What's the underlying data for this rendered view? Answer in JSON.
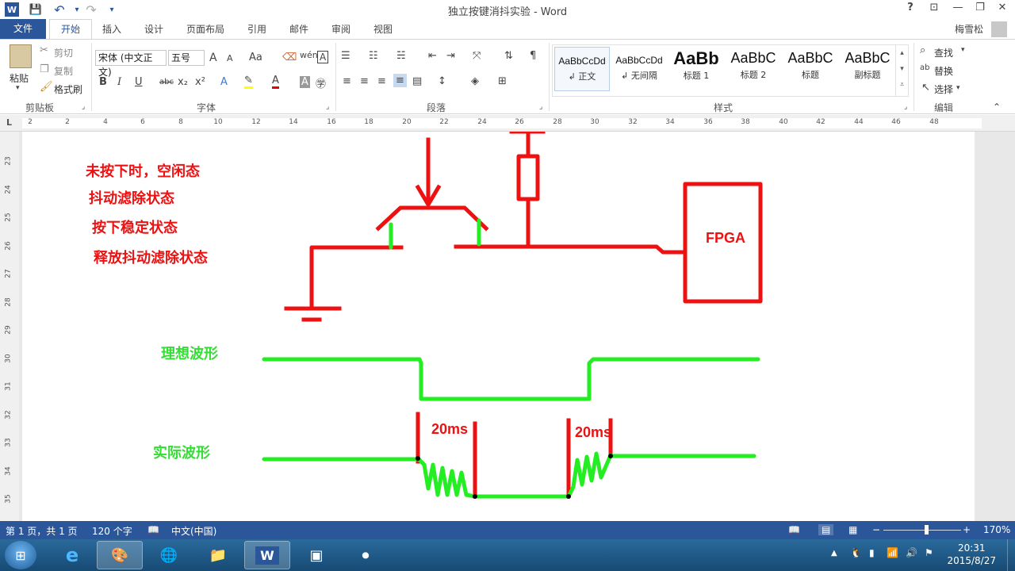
{
  "window": {
    "title": "独立按键消抖实验 - Word",
    "help": "?",
    "ribbon_display": "⊡",
    "minimize": "—",
    "restore": "❐",
    "close": "✕"
  },
  "quick_access": {
    "save": "💾",
    "undo": "↶",
    "redo": "↷",
    "customize": "▾"
  },
  "tabs": [
    "插入",
    "设计",
    "页面布局",
    "引用",
    "邮件",
    "审阅",
    "视图"
  ],
  "file_tab": "文件",
  "home_tab": "开始",
  "user": "梅雪松",
  "ribbon": {
    "clipboard": {
      "paste": "粘贴",
      "cut": "剪切",
      "copy": "复制",
      "format_painter": "格式刷",
      "label": "剪贴板"
    },
    "font": {
      "font_name": "宋体 (中文正文)",
      "font_size": "五号",
      "grow": "A",
      "shrink": "A",
      "change_case": "Aa",
      "bold": "B",
      "italic": "I",
      "underline": "U",
      "strike": "abc",
      "subscript": "x₂",
      "superscript": "x²",
      "label": "字体"
    },
    "paragraph": {
      "label": "段落"
    },
    "styles": {
      "items": [
        {
          "preview": "AaBbCcDd",
          "name": "↲ 正文"
        },
        {
          "preview": "AaBbCcDd",
          "name": "↲ 无间隔"
        },
        {
          "preview": "AaBb",
          "name": "标题 1"
        },
        {
          "preview": "AaBbC",
          "name": "标题 2"
        },
        {
          "preview": "AaBbC",
          "name": "标题"
        },
        {
          "preview": "AaBbC",
          "name": "副标题"
        }
      ],
      "label": "样式"
    },
    "editing": {
      "find": "查找",
      "replace": "替换",
      "select": "选择",
      "label": "编辑"
    }
  },
  "ruler": {
    "h_marks": [
      "2",
      "2",
      "4",
      "6",
      "8",
      "10",
      "12",
      "14",
      "16",
      "18",
      "20",
      "22",
      "24",
      "26",
      "28",
      "30",
      "32",
      "34",
      "36",
      "38",
      "40",
      "42",
      "44",
      "46",
      "48"
    ],
    "v_marks": [
      "23",
      "24",
      "25",
      "26",
      "27",
      "28",
      "29",
      "30",
      "31",
      "32",
      "33",
      "34",
      "35"
    ],
    "corner": "L"
  },
  "document": {
    "states": [
      "未按下时，空闲态",
      "抖动滤除状态",
      "按下稳定状态",
      "释放抖动滤除状态"
    ],
    "fpga_label": "FPGA",
    "ideal_label": "理想波形",
    "actual_label": "实际波形",
    "delay1": "20ms",
    "delay2": "20ms",
    "colors": {
      "red": "#ee1111",
      "green": "#22ee22",
      "label_green": "#33dd33"
    }
  },
  "status": {
    "page": "第 1 页，共 1 页",
    "words": "120 个字",
    "language": "中文(中国)",
    "zoom": "170%"
  },
  "taskbar": {
    "items": [
      "start-orb",
      "internet-explorer",
      "paint",
      "network-app",
      "file-explorer",
      "word",
      "terminal-app",
      "recorder-app"
    ],
    "time": "20:31",
    "date": "2015/8/27"
  }
}
